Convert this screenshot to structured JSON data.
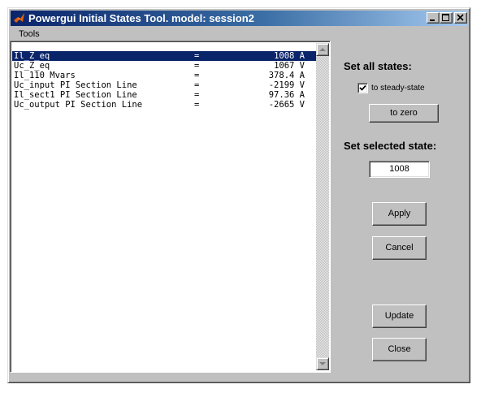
{
  "window": {
    "title": "Powergui Initial States Tool. model: session2",
    "minimize_icon": "minimize-icon",
    "maximize_icon": "maximize-icon",
    "close_icon": "close-icon",
    "app_icon": "matlab-logo-icon"
  },
  "menu": {
    "items": [
      {
        "label": "Tools"
      }
    ]
  },
  "states": {
    "rows": [
      {
        "name": "Il_Z_eq",
        "eq": "=",
        "value": "1008 A"
      },
      {
        "name": "Uc_Z_eq",
        "eq": "=",
        "value": "1067 V"
      },
      {
        "name": "Il_110 Mvars",
        "eq": "=",
        "value": "378.4 A"
      },
      {
        "name": "Uc_input PI Section Line",
        "eq": "=",
        "value": "-2199 V"
      },
      {
        "name": "Il_sect1 PI Section Line",
        "eq": "=",
        "value": "97.36 A"
      },
      {
        "name": "Uc_output PI Section Line",
        "eq": "=",
        "value": "-2665 V"
      }
    ],
    "selected_index": 0
  },
  "set_all": {
    "heading": "Set all states:",
    "checkbox_label": "to steady-state",
    "checkbox_checked": true,
    "zero_button": "to zero"
  },
  "set_selected": {
    "heading": "Set selected state:",
    "value": "1008"
  },
  "buttons": {
    "apply": "Apply",
    "cancel": "Cancel",
    "update": "Update",
    "close": "Close"
  },
  "colors": {
    "selection": "#0a246a",
    "face": "#c0c0c0",
    "title_start": "#0a246a",
    "title_end": "#a6caf0"
  }
}
